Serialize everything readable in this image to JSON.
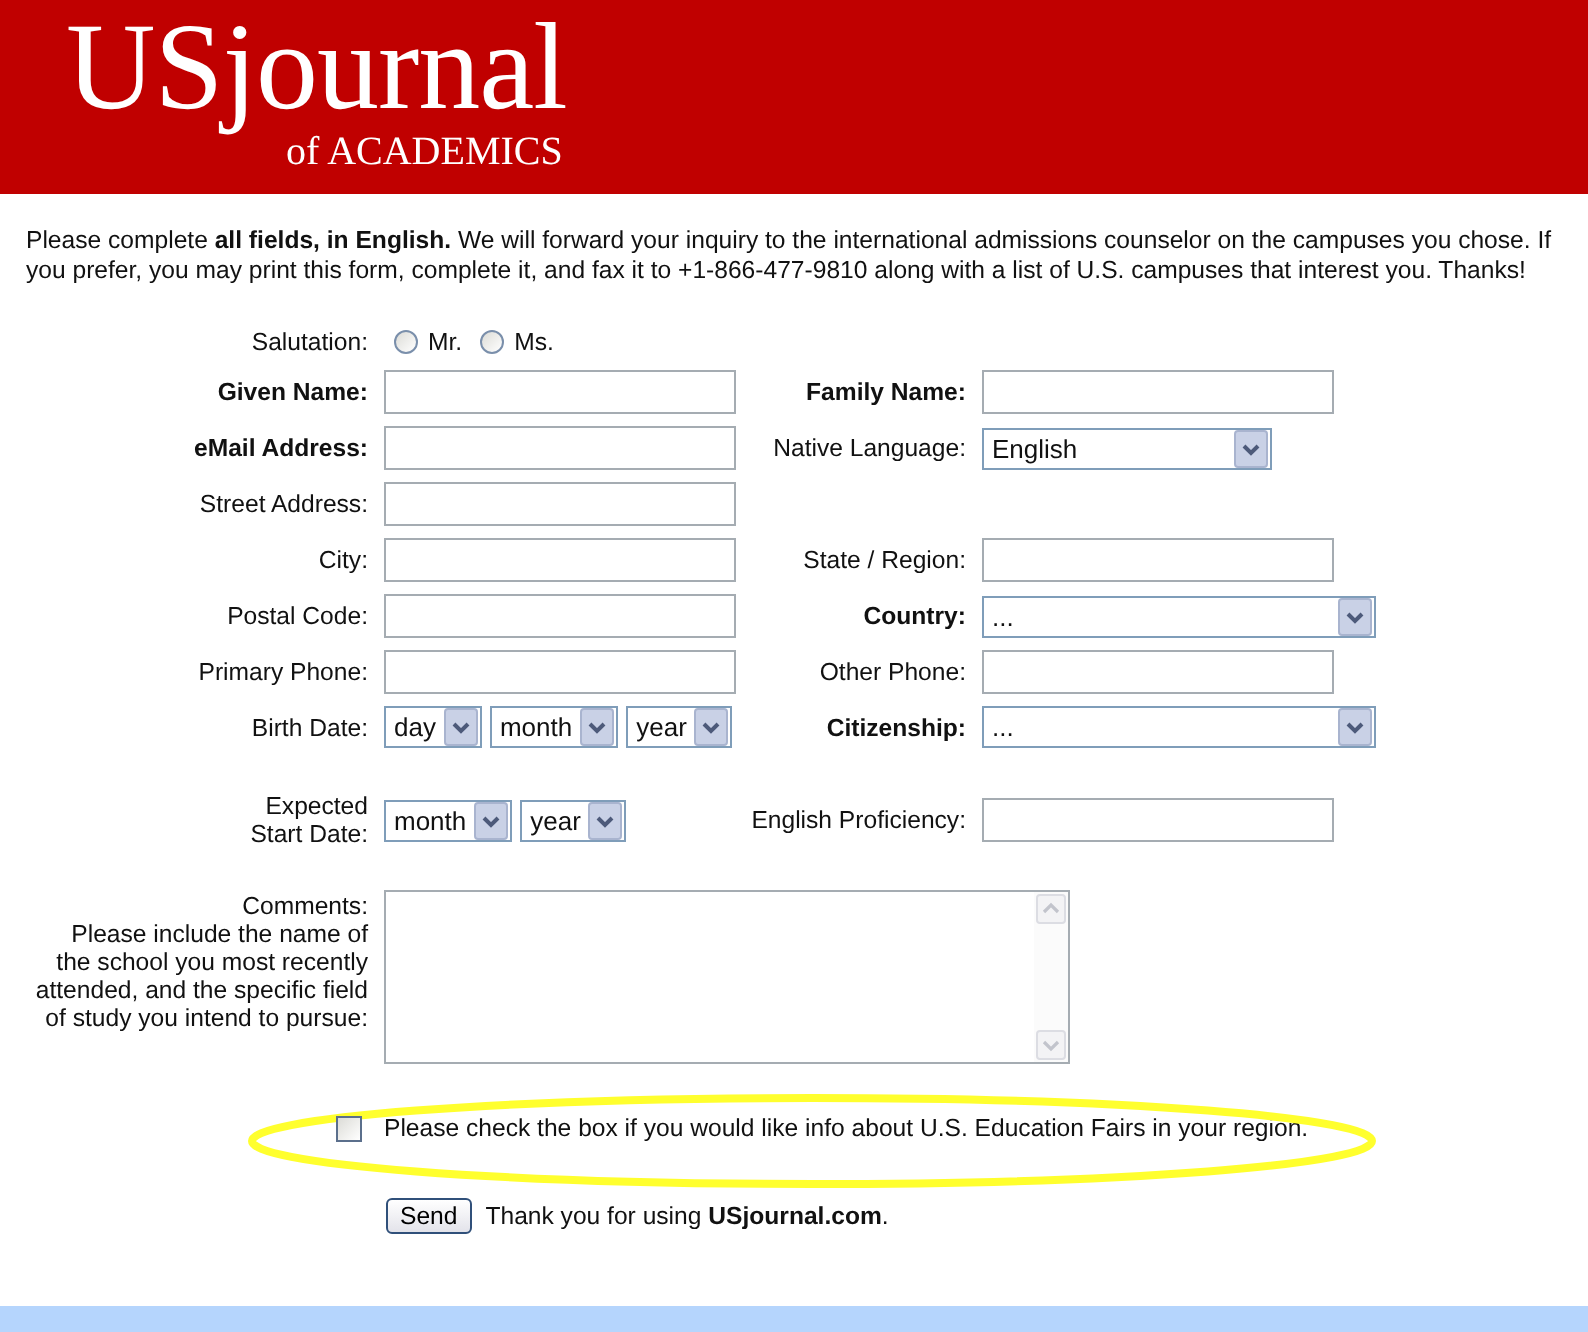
{
  "header": {
    "logo_title": "USjournal",
    "logo_subtitle": "of ACADEMICS"
  },
  "intro": "Please complete **all fields, in English.** We will forward your inquiry to the international admissions counselor on the campuses you chose. If you prefer, you may print this form, complete it, and fax it to +1-866-477-9810 along with a list of U.S. campuses that interest you. Thanks!",
  "form": {
    "rows": [
      {
        "left": {
          "label": "Salutation:",
          "bold": false,
          "kind": "radio",
          "options": [
            {
              "label": "Mr.",
              "selected": false
            },
            {
              "label": "Ms.",
              "selected": false
            }
          ]
        }
      },
      {
        "left": {
          "label": "Given Name:",
          "bold": true,
          "kind": "text"
        },
        "right": {
          "label": "Family Name:",
          "bold": true,
          "kind": "text"
        }
      },
      {
        "left": {
          "label": "eMail Address:",
          "bold": true,
          "kind": "text"
        },
        "right": {
          "label": "Native Language:",
          "bold": false,
          "kind": "select",
          "value": "English"
        }
      },
      {
        "left": {
          "label": "Street Address:",
          "bold": false,
          "kind": "text"
        }
      },
      {
        "left": {
          "label": "City:",
          "bold": false,
          "kind": "text"
        },
        "right": {
          "label": "State / Region:",
          "bold": false,
          "kind": "text"
        }
      },
      {
        "left": {
          "label": "Postal Code:",
          "bold": false,
          "kind": "text"
        },
        "right": {
          "label": "Country:",
          "bold": true,
          "kind": "select",
          "value": "..."
        }
      },
      {
        "left": {
          "label": "Primary Phone:",
          "bold": false,
          "kind": "text"
        },
        "right": {
          "label": "Other Phone:",
          "bold": false,
          "kind": "text"
        }
      },
      {
        "left": {
          "label": "Birth Date:",
          "bold": false,
          "kind": "selects",
          "selects": [
            "day",
            "month",
            "year"
          ]
        },
        "right": {
          "label": "Citizenship:",
          "bold": true,
          "kind": "select",
          "value": "..."
        }
      },
      {
        "left": {
          "label": "Expected\nStart Date:",
          "bold": false,
          "kind": "selects",
          "selects": [
            "month",
            "year"
          ]
        },
        "right": {
          "label": "English Proficiency:",
          "bold": false,
          "kind": "text"
        }
      },
      {
        "left": {
          "label": "Comments:",
          "note": "Please include the name of the school you most recently attended, and the specific field of study you intend to pursue:",
          "bold": false,
          "kind": "textarea"
        }
      }
    ]
  },
  "fairs_opt_in": {
    "label": "Please check the box if you would like info about U.S. Education Fairs in your region.",
    "checked": false,
    "highlighted": true
  },
  "submit": {
    "button": "Send",
    "note": "Thank you for using **USjournal.com**."
  }
}
